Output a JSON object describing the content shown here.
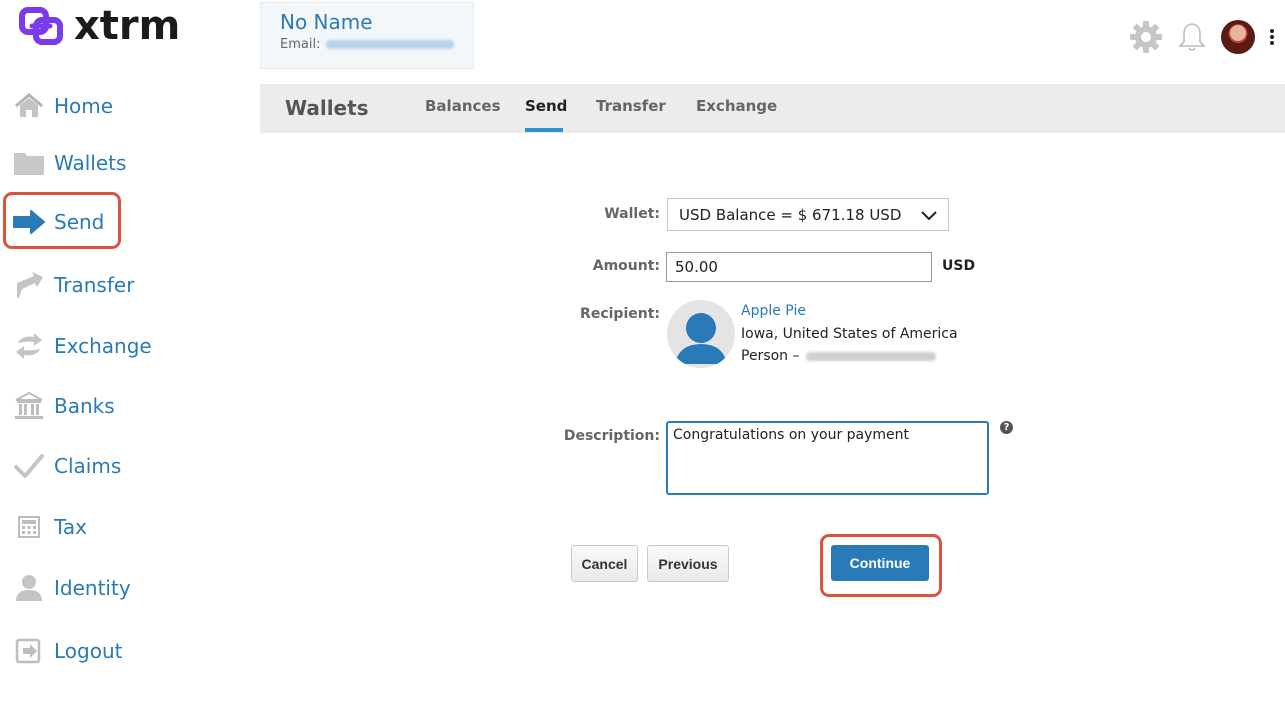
{
  "brand": {
    "name": "xtrm",
    "accent": "#2a7ab8",
    "logo_color": "#7c3aed"
  },
  "account": {
    "name": "No Name",
    "email_label": "Email:"
  },
  "sidebar": {
    "items": [
      {
        "label": "Home",
        "icon": "home-icon"
      },
      {
        "label": "Wallets",
        "icon": "folder-icon"
      },
      {
        "label": "Send",
        "icon": "send-arrow-icon",
        "highlighted": true
      },
      {
        "label": "Transfer",
        "icon": "transfer-icon"
      },
      {
        "label": "Exchange",
        "icon": "exchange-icon"
      },
      {
        "label": "Banks",
        "icon": "bank-icon"
      },
      {
        "label": "Claims",
        "icon": "checkmark-icon"
      },
      {
        "label": "Tax",
        "icon": "calculator-icon"
      },
      {
        "label": "Identity",
        "icon": "person-icon"
      },
      {
        "label": "Logout",
        "icon": "logout-icon"
      }
    ]
  },
  "header": {
    "icons": [
      "gear-icon",
      "bell-icon",
      "avatar",
      "kebab-menu-icon"
    ]
  },
  "tabs": {
    "title": "Wallets",
    "items": [
      {
        "label": "Balances"
      },
      {
        "label": "Send",
        "active": true
      },
      {
        "label": "Transfer"
      },
      {
        "label": "Exchange"
      }
    ]
  },
  "form": {
    "wallet_label": "Wallet:",
    "wallet_value": "USD Balance = $ 671.18 USD",
    "amount_label": "Amount:",
    "amount_value": "50.00",
    "amount_unit": "USD",
    "recipient_label": "Recipient:",
    "recipient_name": "Apple Pie",
    "recipient_location": "Iowa, United States of America",
    "recipient_type": "Person –",
    "description_label": "Description:",
    "description_value": "Congratulations on your payment",
    "help_glyph": "?"
  },
  "buttons": {
    "cancel": "Cancel",
    "previous": "Previous",
    "continue": "Continue"
  }
}
